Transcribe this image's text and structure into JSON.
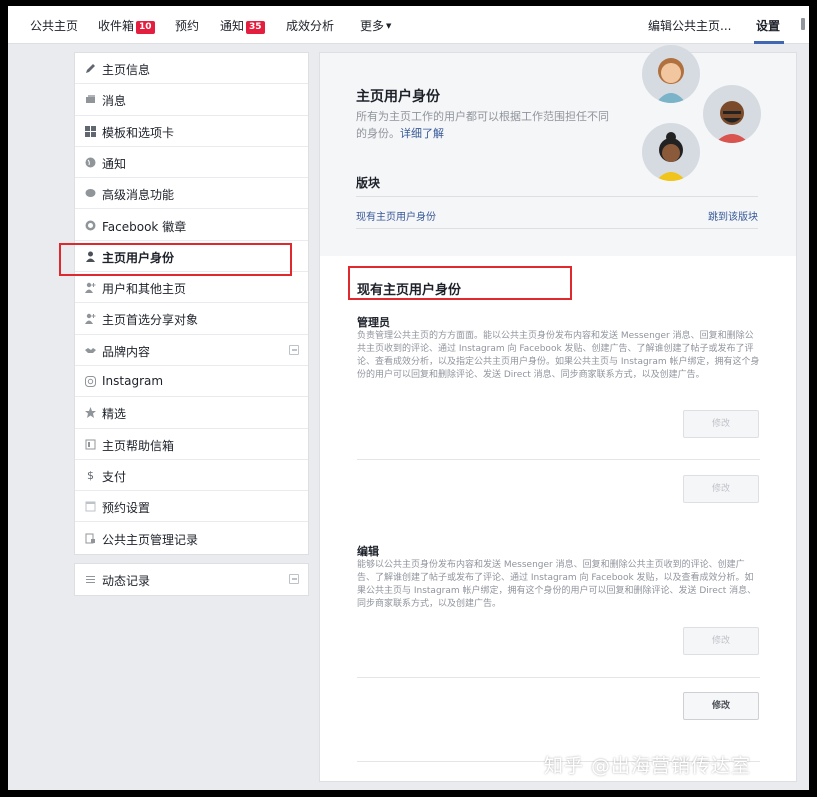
{
  "topnav": {
    "home": "公共主页",
    "inbox": "收件箱",
    "inbox_count": "10",
    "booking": "预约",
    "notifications": "通知",
    "notifications_count": "35",
    "insights": "成效分析",
    "more": "更多",
    "edit_page": "编辑公共主页...",
    "settings": "设置"
  },
  "sidebar": {
    "items": [
      {
        "label": "主页信息",
        "icon": "pencil-icon"
      },
      {
        "label": "消息",
        "icon": "message-icon"
      },
      {
        "label": "模板和选项卡",
        "icon": "grid-icon"
      },
      {
        "label": "通知",
        "icon": "globe-icon"
      },
      {
        "label": "高级消息功能",
        "icon": "chat-icon"
      },
      {
        "label": "Facebook 徽章",
        "icon": "badge-icon"
      },
      {
        "label": "主页用户身份",
        "icon": "person-icon"
      },
      {
        "label": "用户和其他主页",
        "icon": "person-plus-icon"
      },
      {
        "label": "主页首选分享对象",
        "icon": "person-plus-icon"
      },
      {
        "label": "品牌内容",
        "icon": "handshake-icon"
      },
      {
        "label": "Instagram",
        "icon": "instagram-icon"
      },
      {
        "label": "精选",
        "icon": "star-icon"
      },
      {
        "label": "主页帮助信箱",
        "icon": "inbox-icon"
      },
      {
        "label": "支付",
        "icon": "dollar-icon"
      },
      {
        "label": "预约设置",
        "icon": "calendar-icon"
      },
      {
        "label": "公共主页管理记录",
        "icon": "log-icon"
      }
    ],
    "activity_log": "动态记录"
  },
  "main": {
    "title": "主页用户身份",
    "desc": "所有为主页工作的用户都可以根据工作范围担任不同的身份。",
    "learn_more": "详细了解",
    "section_label": "版块",
    "section_link": "现有主页用户身份",
    "jump_link": "跳到该版块",
    "current_title": "现有主页用户身份",
    "admin_title": "管理员",
    "admin_desc": "负责管理公共主页的方方面面。能以公共主页身份发布内容和发送 Messenger 消息、回复和删除公共主页收到的评论、通过 Instagram 向 Facebook 发贴、创建广告、了解谁创建了帖子或发布了评论、查看成效分析，以及指定公共主页用户身份。如果公共主页与 Instagram 帐户绑定，拥有这个身份的用户可以回复和删除评论、发送 Direct 消息、同步商家联系方式，以及创建广告。",
    "editor_title": "编辑",
    "editor_desc": "能够以公共主页身份发布内容和发送 Messenger 消息、回复和删除公共主页收到的评论、创建广告、了解谁创建了帖子或发布了评论、通过 Instagram 向 Facebook 发贴，以及查看成效分析。如果公共主页与 Instagram 帐户绑定，拥有这个身份的用户可以回复和删除评论、发送 Direct 消息、同步商家联系方式，以及创建广告。",
    "modify": "修改"
  },
  "watermark": "知乎 @出海营销传达室"
}
